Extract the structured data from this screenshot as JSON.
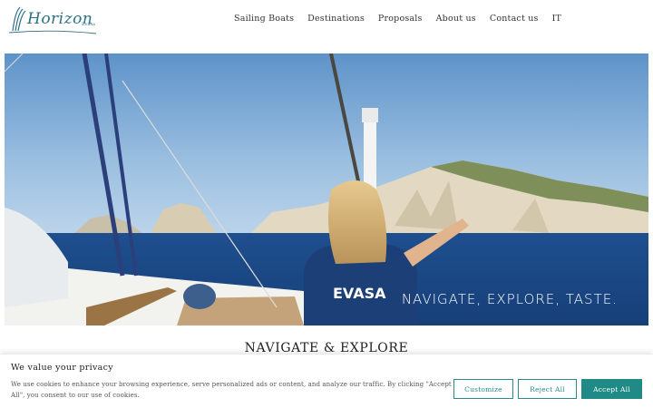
{
  "brand": {
    "name": "Horizon",
    "suffix": "Evasa"
  },
  "nav": {
    "items": [
      "Sailing Boats",
      "Destinations",
      "Proposals",
      "About us",
      "Contact us",
      "IT"
    ]
  },
  "hero": {
    "tagline": "NAVIGATE, EXPLORE, TASTE.",
    "shirt_text": "EVASA"
  },
  "section": {
    "title": "NAVIGATE & EXPLORE"
  },
  "cookie": {
    "title": "We value your privacy",
    "text": "We use cookies to enhance your browsing experience, serve personalized ads or content, and analyze our traffic. By clicking \"Accept All\", you consent to our use of cookies.",
    "customize": "Customize",
    "reject": "Reject All",
    "accept": "Accept All"
  },
  "colors": {
    "accent": "#1f8a86",
    "brand": "#2b6f86"
  }
}
